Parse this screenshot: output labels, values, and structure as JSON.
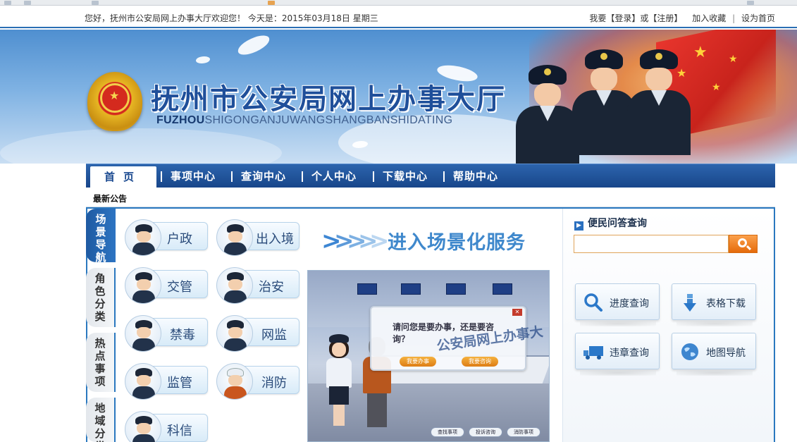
{
  "topbar": {
    "welcome": "您好，抚州市公安局网上办事大厅欢迎您！ 今天是：2015年03月18日 星期三",
    "login_prefix": "我要【",
    "login": "登录",
    "mid": "】或【",
    "register": "注册",
    "suffix": "】",
    "favorite": "加入收藏",
    "homepage": "设为首页"
  },
  "banner": {
    "title": "抚州市公安局网上办事大厅",
    "subtitle_bold": "FUZHOU",
    "subtitle_rest": "SHIGONGANJUWANGSHANGBANSHIDATING",
    "flag_color": "#d9301f"
  },
  "nav": {
    "items": [
      "首页",
      "事项中心",
      "查询中心",
      "个人中心",
      "下载中心",
      "帮助中心"
    ],
    "active_index": 0
  },
  "notice": {
    "label": "最新公告"
  },
  "side_tabs": [
    {
      "label": "场景导航",
      "active": true
    },
    {
      "label": "角色分类",
      "active": false
    },
    {
      "label": "热点事项",
      "active": false
    },
    {
      "label": "地域分类",
      "active": false
    }
  ],
  "services": [
    "户政",
    "出入境",
    "交管",
    "治安",
    "禁毒",
    "网监",
    "监管",
    "消防",
    "科信"
  ],
  "enter_banner": {
    "label": "进入场景化服务"
  },
  "scene": {
    "question": "请问您是要办事，还是要咨询？",
    "overlay_title": "公安局网上办事大",
    "btn_do": "我要办事",
    "btn_ask": "我要咨询",
    "tabs": [
      "查找事项",
      "投诉咨询",
      "消防事项"
    ]
  },
  "qa": {
    "title": "便民问答查询",
    "input_value": "",
    "placeholder": ""
  },
  "quick_links": [
    {
      "label": "进度查询",
      "icon": "magnifier-icon"
    },
    {
      "label": "表格下载",
      "icon": "download-arrow-icon"
    },
    {
      "label": "违章查询",
      "icon": "truck-icon"
    },
    {
      "label": "地图导航",
      "icon": "globe-icon"
    }
  ]
}
